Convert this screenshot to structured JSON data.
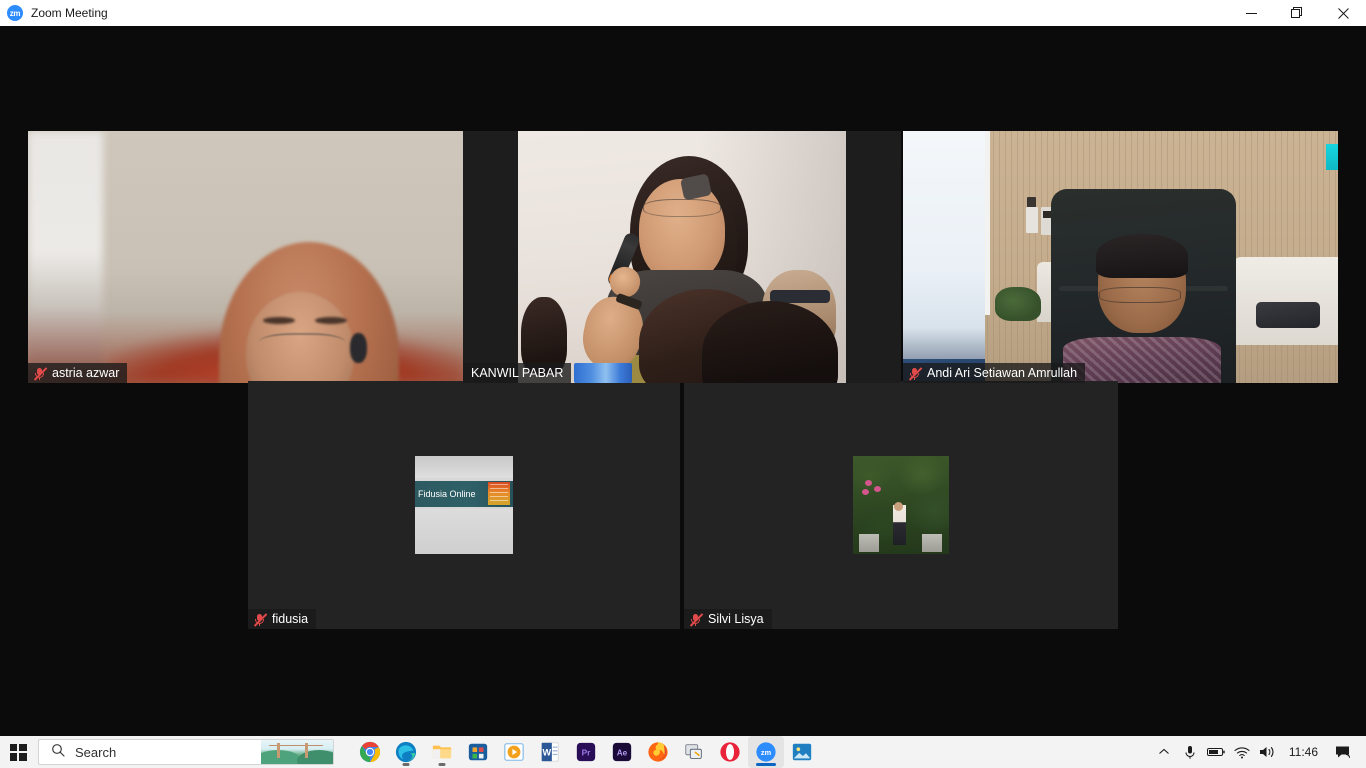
{
  "window": {
    "title": "Zoom Meeting",
    "app_icon": "zoom-icon",
    "icon_text": "zm",
    "controls": {
      "minimize": "minimize-button",
      "restore": "restore-button",
      "close": "close-button"
    }
  },
  "meeting": {
    "layout": "gallery-view",
    "active_speaker_color": "#c5e85a",
    "tiles": [
      {
        "name": "astria azwar",
        "video_on": true,
        "muted": true,
        "active_speaker": false,
        "mic_icon": "mic-muted-icon",
        "description": "woman wearing brown hijab and glasses in front of beige wall"
      },
      {
        "name": "KANWIL PABAR",
        "video_on": true,
        "muted": false,
        "active_speaker": true,
        "mic_icon": "",
        "description": "woman speaking into microphone at a seminar with audience in foreground"
      },
      {
        "name": "Andi Ari Setiawan Amrullah",
        "video_on": true,
        "muted": true,
        "active_speaker": false,
        "mic_icon": "mic-muted-icon",
        "description": "man with glasses in batik shirt seated in black office chair"
      },
      {
        "name": "fidusia",
        "video_on": false,
        "muted": true,
        "active_speaker": false,
        "mic_icon": "mic-muted-icon",
        "avatar_label": "Fidusia Online",
        "description": "avatar photo of Fidusia Online signage banner"
      },
      {
        "name": "Silvi Lisya",
        "video_on": false,
        "muted": true,
        "active_speaker": false,
        "mic_icon": "mic-muted-icon",
        "description": "avatar photo of person standing among green plants with pink flowers"
      }
    ]
  },
  "taskbar": {
    "start": "windows-start-icon",
    "search": {
      "placeholder": "Search",
      "icon": "search-icon",
      "thumbnail": "bridge-thumbnail"
    },
    "apps": [
      {
        "name": "google-chrome",
        "running": false,
        "active": false
      },
      {
        "name": "microsoft-edge",
        "running": true,
        "active": false
      },
      {
        "name": "file-explorer",
        "running": true,
        "active": false
      },
      {
        "name": "microsoft-store",
        "running": false,
        "active": false
      },
      {
        "name": "media-player",
        "running": false,
        "active": false
      },
      {
        "name": "microsoft-word",
        "running": false,
        "active": false
      },
      {
        "name": "adobe-premiere-pro",
        "running": false,
        "active": false
      },
      {
        "name": "adobe-after-effects",
        "running": false,
        "active": false
      },
      {
        "name": "mozilla-firefox",
        "running": false,
        "active": false
      },
      {
        "name": "snipping-tool",
        "running": false,
        "active": false
      },
      {
        "name": "opera-browser",
        "running": false,
        "active": false
      },
      {
        "name": "zoom",
        "running": true,
        "active": true
      },
      {
        "name": "photos-gallery",
        "running": false,
        "active": false
      }
    ],
    "tray": {
      "overflow": "chevron-up-icon",
      "microphone": "microphone-icon",
      "battery": "battery-icon",
      "network": "wifi-icon",
      "volume": "volume-icon",
      "clock": "11:46",
      "notifications": "notification-icon"
    }
  }
}
